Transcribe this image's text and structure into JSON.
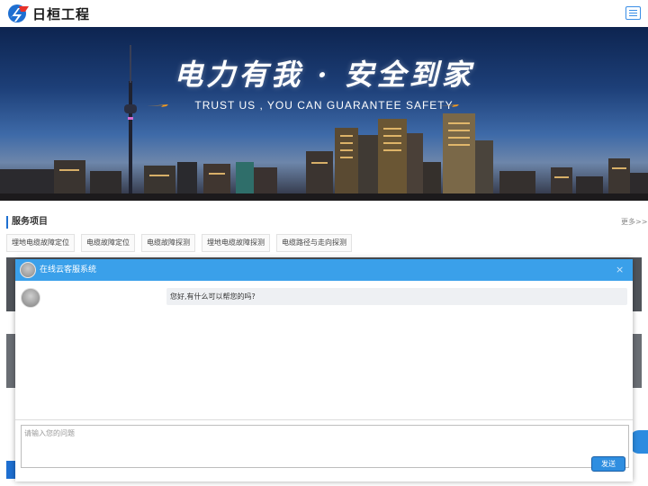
{
  "header": {
    "logo_text": "日桓工程",
    "logo_icon": "logo-icon",
    "menu_icon": "hamburger-menu-icon"
  },
  "banner": {
    "slogan": "电力有我 · 安全到家",
    "subtitle": "TRUST US , YOU CAN GUARANTEE SAFETY"
  },
  "services": {
    "title": "服务项目",
    "more": "更多>>",
    "tags": [
      "埋地电缆故障定位",
      "电缆故障定位",
      "电缆故障探测",
      "埋地电缆故障探测",
      "电缆路径与走向探测"
    ]
  },
  "chat": {
    "title": "在线云客服系统",
    "close": "×",
    "messages": [
      {
        "from": "agent",
        "text": "您好,有什么可以帮您的吗?"
      }
    ],
    "input_placeholder": "请输入您的问题",
    "send_label": "发送"
  },
  "colors": {
    "accent": "#3aa0ea",
    "brand_blue": "#1e6fd1",
    "send_button": "#2f8ee0"
  }
}
